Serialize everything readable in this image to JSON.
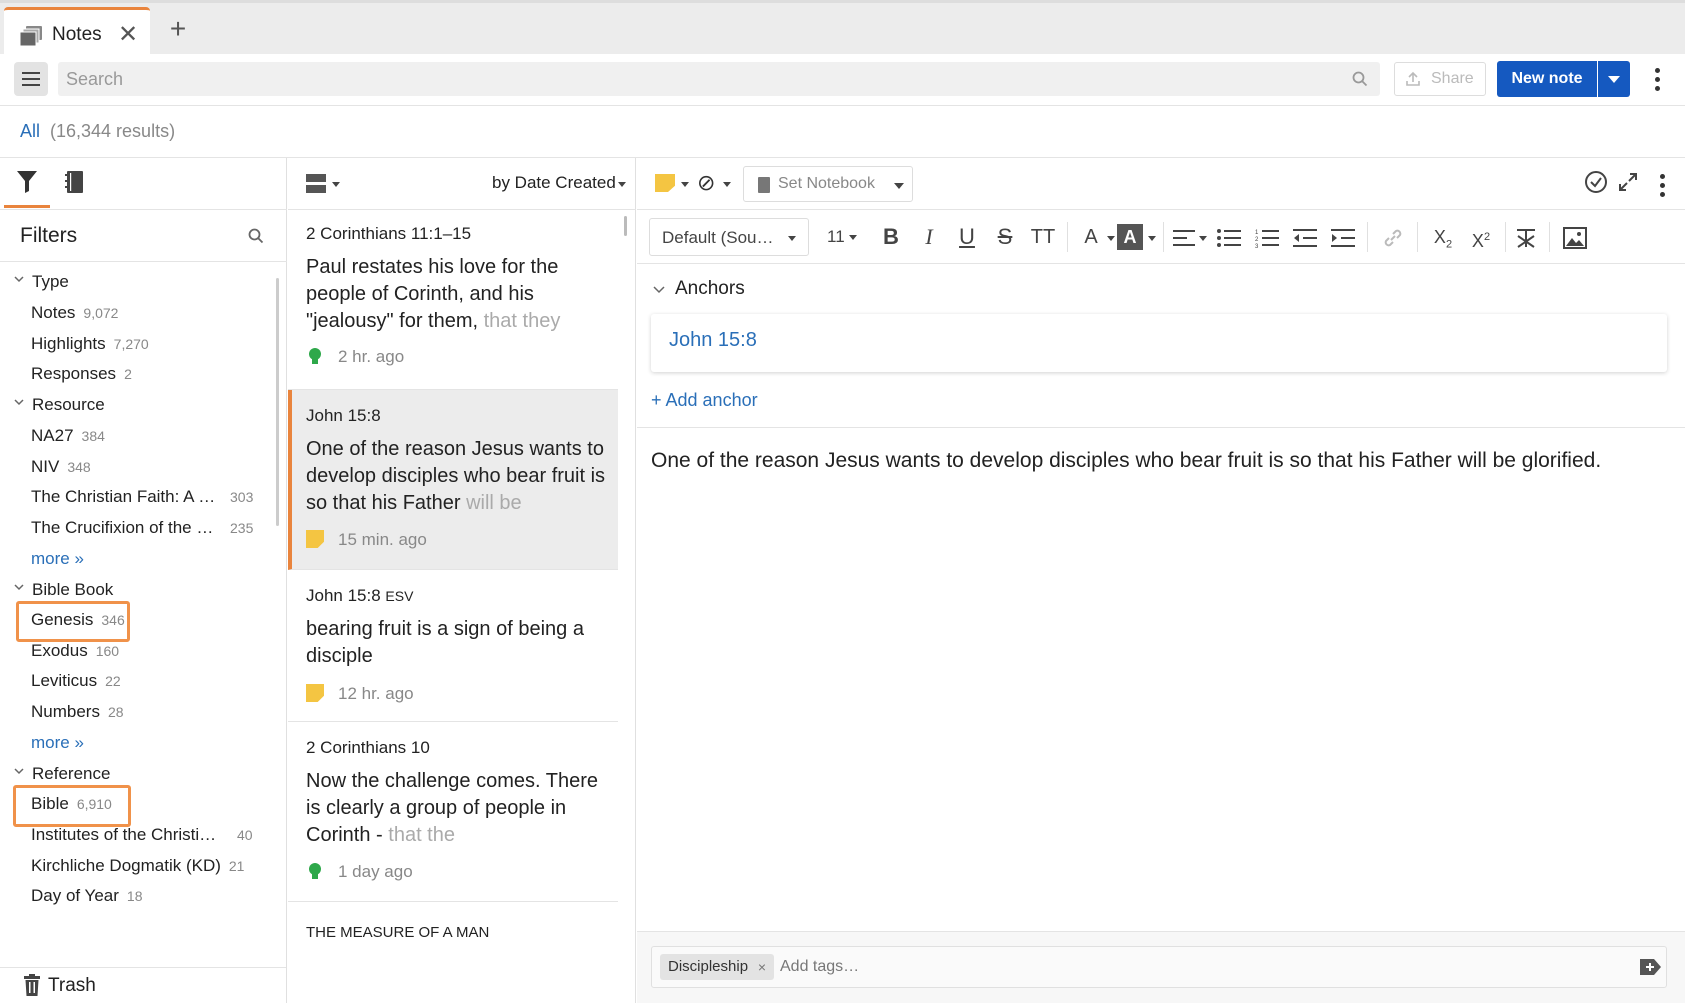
{
  "tab": {
    "title": "Notes"
  },
  "toolbar": {
    "search_placeholder": "Search",
    "share_label": "Share",
    "new_note_label": "New note"
  },
  "results": {
    "scope": "All",
    "count": "(16,344 results)"
  },
  "filters": {
    "title": "Filters",
    "sections": [
      {
        "label": "Type",
        "items": [
          {
            "label": "Notes",
            "count": "9,072"
          },
          {
            "label": "Highlights",
            "count": "7,270"
          },
          {
            "label": "Responses",
            "count": "2"
          }
        ]
      },
      {
        "label": "Resource",
        "items": [
          {
            "label": "NA27",
            "count": "384"
          },
          {
            "label": "NIV",
            "count": "348"
          },
          {
            "label": "The Christian Faith: A …",
            "count": "303"
          },
          {
            "label": "The Crucifixion of the …",
            "count": "235"
          }
        ],
        "more": "more »"
      },
      {
        "label": "Bible Book",
        "items": [
          {
            "label": "Genesis",
            "count": "346"
          },
          {
            "label": "Exodus",
            "count": "160"
          },
          {
            "label": "Leviticus",
            "count": "22"
          },
          {
            "label": "Numbers",
            "count": "28"
          }
        ],
        "more": "more »"
      },
      {
        "label": "Reference",
        "items": [
          {
            "label": "Bible",
            "count": "6,910"
          },
          {
            "label": "Institutes of the Christi…",
            "count": "40"
          },
          {
            "label": "Kirchliche Dogmatik (KD)",
            "count": "21"
          },
          {
            "label": "Day of Year",
            "count": "18"
          }
        ]
      }
    ],
    "trash": "Trash"
  },
  "notes_list": {
    "sort": "by Date Created",
    "notes": [
      {
        "ref": "2 Corinthians 11:1–15",
        "body": "Paul restates his love for the people of Corinth, and his \"jealousy\" for them,",
        "body_fade": "that they",
        "time": "2 hr. ago",
        "icon": "lightbulb-icon"
      },
      {
        "ref": "John 15:8",
        "body": "One of the reason Jesus wants to develop disciples who bear fruit is so that his Father",
        "body_fade": "will be",
        "time": "15 min. ago",
        "icon": "sticky-note-icon"
      },
      {
        "ref": "John 15:8",
        "ref_suffix": "ESV",
        "body": "bearing fruit is a sign of being a disciple",
        "body_fade": "",
        "time": "12 hr. ago",
        "icon": "sticky-note-icon"
      },
      {
        "ref": "2 Corinthians 10",
        "body": "Now the challenge comes. There is clearly a group of people in Corinth -",
        "body_fade": "that the",
        "time": "1 day ago",
        "icon": "lightbulb-icon"
      },
      {
        "ref": "THE MEASURE OF A MAN",
        "body": "",
        "body_fade": "",
        "time": "",
        "icon": ""
      }
    ]
  },
  "editor": {
    "set_notebook": "Set Notebook",
    "font": "Default (Sou…",
    "size": "11",
    "anchors_title": "Anchors",
    "anchor": "John 15:8",
    "add_anchor": "+ Add anchor",
    "content": "One of the reason Jesus wants to develop disciples who bear fruit is so that his Father will be glorified.",
    "tags": [
      "Discipleship"
    ],
    "tag_placeholder": "Add tags…"
  },
  "colors": {
    "accent": "#e9843d",
    "link": "#2a6fb8",
    "primary": "#1559c0",
    "highlight_box": "#f0924a"
  }
}
